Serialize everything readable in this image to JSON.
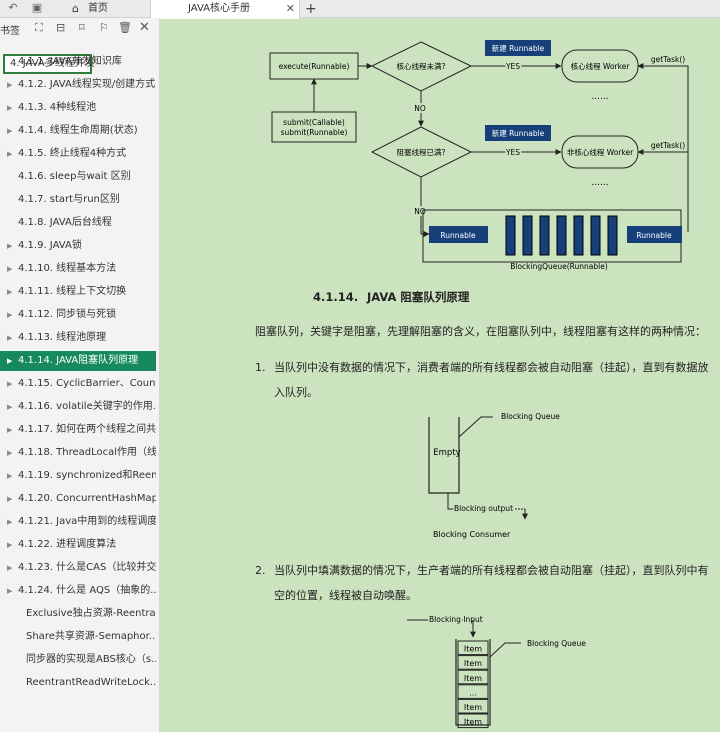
{
  "tabbar": {
    "home_label": "首页",
    "doc_label": "JAVA核心手册",
    "close_glyph": "✕",
    "new_tab_glyph": "+"
  },
  "sidebar": {
    "title": "书签",
    "root": "4. JAVA多线程并发",
    "items": [
      {
        "label": "4.1.1. JAVA并发知识库",
        "arrow": false
      },
      {
        "label": "4.1.2. JAVA线程实现/创建方式",
        "arrow": true
      },
      {
        "label": "4.1.3. 4种线程池",
        "arrow": true
      },
      {
        "label": "4.1.4. 线程生命周期(状态)",
        "arrow": true
      },
      {
        "label": "4.1.5. 终止线程4种方式",
        "arrow": true
      },
      {
        "label": "4.1.6. sleep与wait 区别",
        "arrow": false
      },
      {
        "label": "4.1.7. start与run区别",
        "arrow": false
      },
      {
        "label": "4.1.8. JAVA后台线程",
        "arrow": false
      },
      {
        "label": "4.1.9. JAVA锁",
        "arrow": true
      },
      {
        "label": "4.1.10. 线程基本方法",
        "arrow": true
      },
      {
        "label": "4.1.11. 线程上下文切换",
        "arrow": true
      },
      {
        "label": "4.1.12. 同步锁与死锁",
        "arrow": true
      },
      {
        "label": "4.1.13. 线程池原理",
        "arrow": true
      },
      {
        "label": "4.1.14. JAVA阻塞队列原理",
        "arrow": true,
        "active": true
      },
      {
        "label": "4.1.15. CyclicBarrier、Count...",
        "arrow": true
      },
      {
        "label": "4.1.16. volatile关键字的作用...",
        "arrow": true
      },
      {
        "label": "4.1.17. 如何在两个线程之间共...",
        "arrow": true
      },
      {
        "label": "4.1.18. ThreadLocal作用（线...",
        "arrow": true
      },
      {
        "label": "4.1.19. synchronized和Reent...",
        "arrow": true
      },
      {
        "label": "4.1.20. ConcurrentHashMap...",
        "arrow": true
      },
      {
        "label": "4.1.21. Java中用到的线程调度",
        "arrow": true
      },
      {
        "label": "4.1.22. 进程调度算法",
        "arrow": true
      },
      {
        "label": "4.1.23. 什么是CAS（比较并交...",
        "arrow": true
      },
      {
        "label": "4.1.24. 什么是 AQS（抽象的...",
        "arrow": true
      },
      {
        "label": "Exclusive独占资源-Reentra...",
        "arrow": false,
        "sub": true
      },
      {
        "label": "Share共享资源-Semaphor...",
        "arrow": false,
        "sub": true
      },
      {
        "label": "同步器的实现是ABS核心（s...",
        "arrow": false,
        "sub": true
      },
      {
        "label": "ReentrantReadWriteLock...",
        "arrow": false,
        "sub": true
      }
    ]
  },
  "diagram1": {
    "execute": "execute(Runnable)",
    "submit_1": "submit(Callable)",
    "submit_2": "submit(Runnable)",
    "decision_core": "核心线程未满?",
    "decision_block": "阻塞线程已满?",
    "new_runnable_1": "新建 Runnable",
    "new_runnable_2": "新建 Runnable",
    "yes_1": "YES",
    "yes_2": "YES",
    "no_1": "NO",
    "no_2": "NO",
    "core_worker": "核心线程 Worker",
    "noncore_worker": "非核心线程 Worker",
    "dots": "......",
    "get_task_1": "getTask()",
    "get_task_2": "getTask()",
    "runnable_left": "Runnable",
    "runnable_right": "Runnable",
    "queue_label": "BlockingQueue(Runnable)"
  },
  "section": {
    "number": "4.1.14.",
    "title": "JAVA 阻塞队列原理"
  },
  "body": {
    "intro": "阻塞队列，关键字是阻塞，先理解阻塞的含义，在阻塞队列中，线程阻塞有这样的两种情况：",
    "num1": "1.",
    "item1": "当队列中没有数据的情况下，消费者端的所有线程都会被自动阻塞（挂起），直到有数据放入队列。",
    "num2": "2.",
    "item2": "当队列中填满数据的情况下，生产者端的所有线程都会被自动阻塞（挂起），直到队列中有空的位置，线程被自动唤醒。"
  },
  "diagram2": {
    "queue_label": "Blocking Queue",
    "empty": "Empty",
    "output": "Blocking output",
    "consumer": "Blocking Consumer"
  },
  "diagram3": {
    "input": "Blocking Input",
    "queue_label": "Blocking Queue",
    "items": [
      "Item",
      "Item",
      "Item",
      "...",
      "Item",
      "Item"
    ]
  },
  "colors": {
    "sidebar_active": "#178a5d",
    "page_bg": "#cce3bf",
    "queue_blue": "#17407a"
  }
}
